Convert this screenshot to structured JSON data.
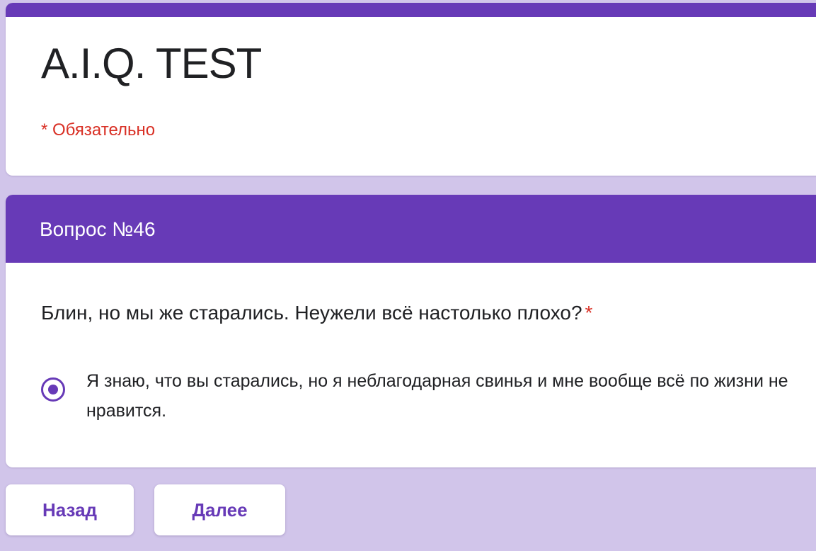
{
  "form": {
    "title": "A.I.Q. TEST",
    "required_note": "* Обязательно"
  },
  "section": {
    "title": "Вопрос №46"
  },
  "question": {
    "text": "Блин, но мы же старались. Неужели всё настолько плохо?",
    "required_star": "*",
    "options": [
      {
        "label": "Я знаю, что вы старались, но я неблагодарная свинья и мне вообще всё по жизни не нравится.",
        "selected": true
      }
    ]
  },
  "navigation": {
    "back_label": "Назад",
    "next_label": "Далее"
  },
  "colors": {
    "accent": "#673ab7",
    "background": "#d1c5ea",
    "required": "#d93025",
    "text": "#202124"
  }
}
